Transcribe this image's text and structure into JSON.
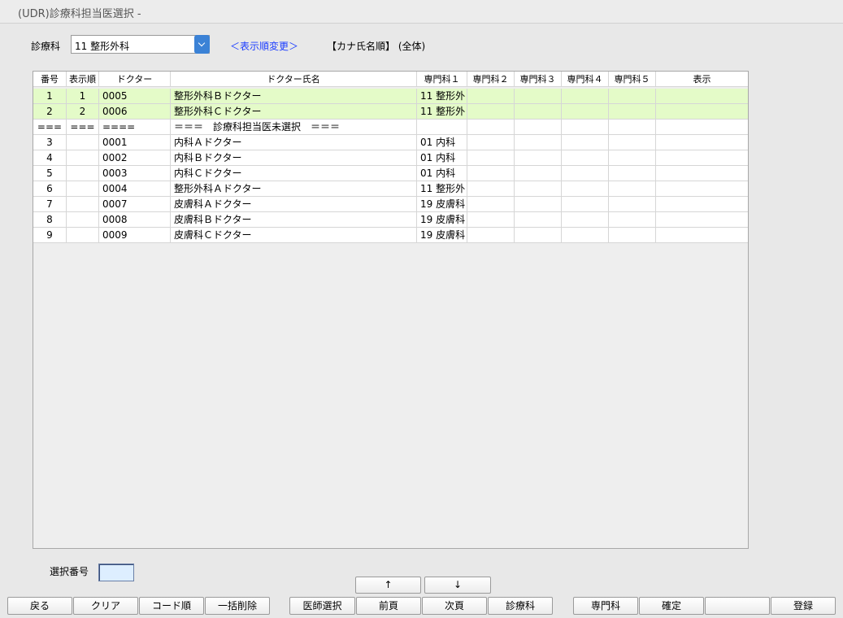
{
  "window": {
    "title": "(UDR)診療科担当医選択 -"
  },
  "filter": {
    "department_label": "診療科",
    "department_value": "11 整形外科",
    "order_link": "＜表示順変更＞",
    "sort_info": "【カナ氏名順】 (全体)"
  },
  "table": {
    "headers": [
      "番号",
      "表示順",
      "ドクター",
      "ドクター氏名",
      "専門科１",
      "専門科２",
      "専門科３",
      "専門科４",
      "専門科５",
      "表示"
    ],
    "rows": [
      {
        "no": "1",
        "order": "1",
        "code": "0005",
        "name": "整形外科Ｂドクター",
        "s1": "11 整形外",
        "s2": "",
        "s3": "",
        "s4": "",
        "s5": "",
        "disp": ""
      },
      {
        "no": "2",
        "order": "2",
        "code": "0006",
        "name": "整形外科Ｃドクター",
        "s1": "11 整形外",
        "s2": "",
        "s3": "",
        "s4": "",
        "s5": "",
        "disp": ""
      },
      {
        "no": "===",
        "order": "===",
        "code": "====",
        "name": "＝＝＝　診療科担当医未選択　＝＝＝",
        "s1": "",
        "s2": "",
        "s3": "",
        "s4": "",
        "s5": "",
        "disp": ""
      },
      {
        "no": "3",
        "order": "",
        "code": "0001",
        "name": "内科Ａドクター",
        "s1": "01 内科",
        "s2": "",
        "s3": "",
        "s4": "",
        "s5": "",
        "disp": ""
      },
      {
        "no": "4",
        "order": "",
        "code": "0002",
        "name": "内科Ｂドクター",
        "s1": "01 内科",
        "s2": "",
        "s3": "",
        "s4": "",
        "s5": "",
        "disp": ""
      },
      {
        "no": "5",
        "order": "",
        "code": "0003",
        "name": "内科Ｃドクター",
        "s1": "01 内科",
        "s2": "",
        "s3": "",
        "s4": "",
        "s5": "",
        "disp": ""
      },
      {
        "no": "6",
        "order": "",
        "code": "0004",
        "name": "整形外科Ａドクター",
        "s1": "11 整形外",
        "s2": "",
        "s3": "",
        "s4": "",
        "s5": "",
        "disp": ""
      },
      {
        "no": "7",
        "order": "",
        "code": "0007",
        "name": "皮膚科Ａドクター",
        "s1": "19 皮膚科",
        "s2": "",
        "s3": "",
        "s4": "",
        "s5": "",
        "disp": ""
      },
      {
        "no": "8",
        "order": "",
        "code": "0008",
        "name": "皮膚科Ｂドクター",
        "s1": "19 皮膚科",
        "s2": "",
        "s3": "",
        "s4": "",
        "s5": "",
        "disp": ""
      },
      {
        "no": "9",
        "order": "",
        "code": "0009",
        "name": "皮膚科Ｃドクター",
        "s1": "19 皮膚科",
        "s2": "",
        "s3": "",
        "s4": "",
        "s5": "",
        "disp": ""
      }
    ]
  },
  "selection": {
    "label": "選択番号",
    "value": ""
  },
  "buttons": {
    "up": "↑",
    "down": "↓",
    "back": "戻る",
    "clear": "クリア",
    "code_order": "コード順",
    "bulk_delete": "一括削除",
    "doctor_select": "医師選択",
    "prev_page": "前頁",
    "next_page": "次頁",
    "department": "診療科",
    "specialty": "専門科",
    "confirm": "確定",
    "blank": "",
    "register": "登録"
  },
  "colors": {
    "selected_row": "#e4fbc8",
    "link": "#1a3cff",
    "select_button": "#3b82d6"
  }
}
